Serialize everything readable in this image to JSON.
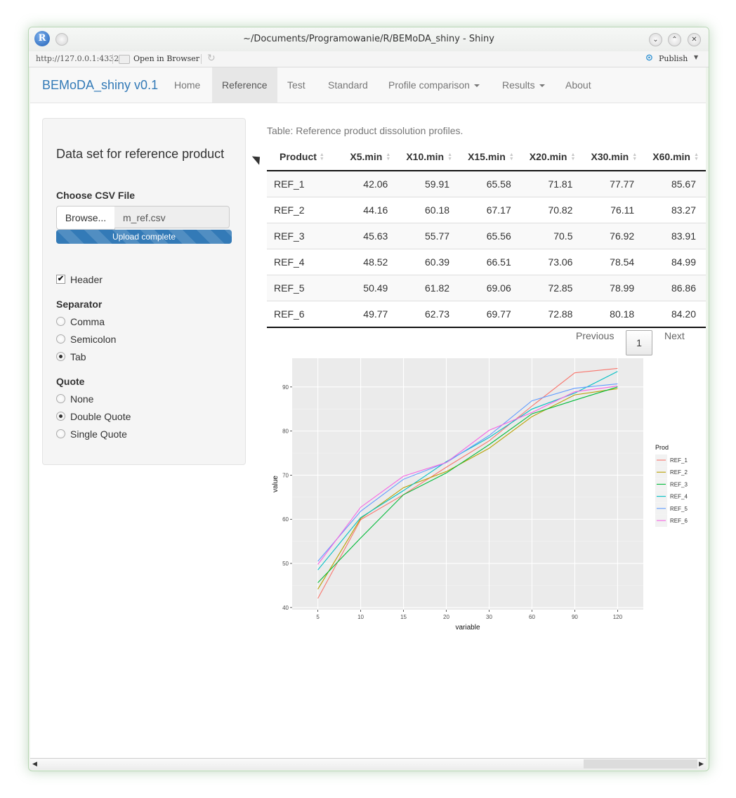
{
  "window": {
    "title": "~/Documents/Programowanie/R/BEMoDA_shiny - Shiny",
    "url": "http://127.0.0.1:4332",
    "open_in_browser": "Open in Browser",
    "publish": "Publish",
    "logo_letter": "R",
    "minimize_glyph": "⌄",
    "maximize_glyph": "⌃",
    "close_glyph": "✕",
    "refresh_glyph": "↻",
    "publish_glyph": "⊙"
  },
  "navbar": {
    "brand": "BEMoDA_shiny v0.1",
    "items": [
      {
        "label": "Home",
        "active": false,
        "dropdown": false
      },
      {
        "label": "Reference",
        "active": true,
        "dropdown": false
      },
      {
        "label": "Test",
        "active": false,
        "dropdown": false
      },
      {
        "label": "Standard",
        "active": false,
        "dropdown": false
      },
      {
        "label": "Profile comparison",
        "active": false,
        "dropdown": true
      },
      {
        "label": "Results",
        "active": false,
        "dropdown": true
      },
      {
        "label": "About",
        "active": false,
        "dropdown": false
      }
    ]
  },
  "sidebar": {
    "title": "Data set for reference product",
    "file_label": "Choose CSV File",
    "browse_label": "Browse...",
    "file_name": "m_ref.csv",
    "upload_status": "Upload complete",
    "upload_progress": 1.0,
    "header_label": "Header",
    "header_checked": true,
    "check_glyph": "✔",
    "separator_label": "Separator",
    "separator_options": [
      "Comma",
      "Semicolon",
      "Tab"
    ],
    "separator_selected": "Tab",
    "quote_label": "Quote",
    "quote_options": [
      "None",
      "Double Quote",
      "Single Quote"
    ],
    "quote_selected": "Double Quote"
  },
  "table": {
    "caption": "Table: Reference product dissolution profiles.",
    "columns": [
      "Product",
      "X5.min",
      "X10.min",
      "X15.min",
      "X20.min",
      "X30.min",
      "X60.min"
    ],
    "rows": [
      [
        "REF_1",
        "42.06",
        "59.91",
        "65.58",
        "71.81",
        "77.77",
        "85.67"
      ],
      [
        "REF_2",
        "44.16",
        "60.18",
        "67.17",
        "70.82",
        "76.11",
        "83.27"
      ],
      [
        "REF_3",
        "45.63",
        "55.77",
        "65.56",
        "70.5",
        "76.92",
        "83.91"
      ],
      [
        "REF_4",
        "48.52",
        "60.39",
        "66.51",
        "73.06",
        "78.54",
        "84.99"
      ],
      [
        "REF_5",
        "50.49",
        "61.82",
        "69.06",
        "72.85",
        "78.99",
        "86.86"
      ],
      [
        "REF_6",
        "49.77",
        "62.73",
        "69.77",
        "72.88",
        "80.18",
        "84.20"
      ]
    ],
    "sort_glyph": "▲▼"
  },
  "pagination": {
    "previous": "Previous",
    "current_page": "1",
    "next": "Next"
  },
  "scrollbar": {
    "left_glyph": "◀",
    "right_glyph": "▶"
  },
  "chart_data": {
    "type": "line",
    "title": "",
    "xlabel": "variable",
    "ylabel": "value",
    "categories": [
      "5",
      "10",
      "15",
      "20",
      "30",
      "60",
      "90",
      "120"
    ],
    "ylim": [
      39.5,
      96.5
    ],
    "yticks": [
      40,
      50,
      60,
      70,
      80,
      90
    ],
    "grid": true,
    "legend_title": "Prod",
    "legend_position": "right",
    "series": [
      {
        "name": "REF_1",
        "color": "#F8766D",
        "values": [
          42.06,
          59.91,
          65.58,
          71.81,
          77.77,
          85.67,
          93.2,
          94.2
        ]
      },
      {
        "name": "REF_2",
        "color": "#B79F00",
        "values": [
          44.16,
          60.18,
          67.17,
          70.82,
          76.11,
          83.27,
          88.2,
          89.6
        ]
      },
      {
        "name": "REF_3",
        "color": "#00BA38",
        "values": [
          45.63,
          55.77,
          65.56,
          70.5,
          76.92,
          83.91,
          87.0,
          90.0
        ]
      },
      {
        "name": "REF_4",
        "color": "#00BFC4",
        "values": [
          48.52,
          60.39,
          66.51,
          73.06,
          78.54,
          84.99,
          88.6,
          93.5
        ]
      },
      {
        "name": "REF_5",
        "color": "#619CFF",
        "values": [
          50.49,
          61.82,
          69.06,
          72.85,
          78.99,
          86.86,
          89.7,
          90.7
        ]
      },
      {
        "name": "REF_6",
        "color": "#F564E3",
        "values": [
          49.77,
          62.73,
          69.77,
          72.88,
          80.18,
          84.2,
          88.9,
          90.2
        ]
      }
    ]
  }
}
